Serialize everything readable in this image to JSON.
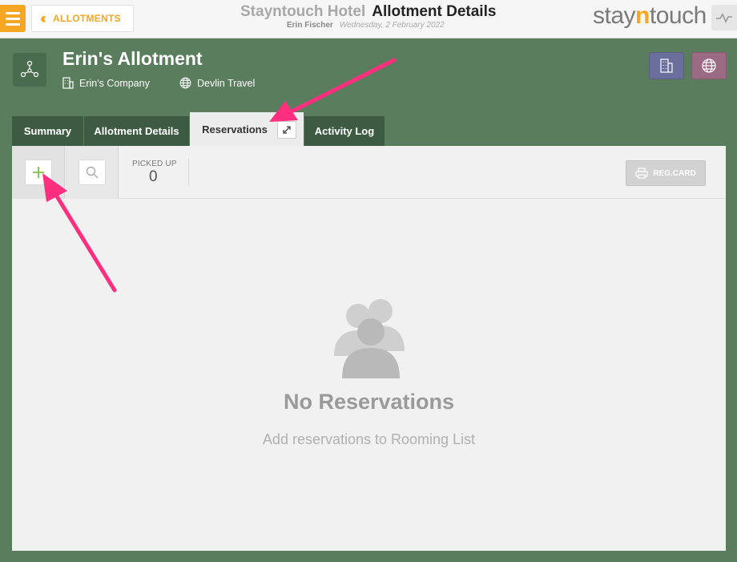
{
  "topbar": {
    "back_label": "ALLOTMENTS",
    "hotel_name": "Stayntouch Hotel",
    "page_title": "Allotment Details",
    "user_name": "Erin Fischer",
    "date": "Wednesday, 2 February 2022",
    "logo": {
      "pre": "stay",
      "mid": "n",
      "post": "touch"
    }
  },
  "allotment": {
    "name": "Erin's Allotment",
    "company": "Erin's Company",
    "travel_agent": "Devlin Travel"
  },
  "tabs": [
    {
      "label": "Summary"
    },
    {
      "label": "Allotment Details"
    },
    {
      "label": "Reservations"
    },
    {
      "label": "Activity Log"
    }
  ],
  "toolbar": {
    "picked_up_label": "PICKED UP",
    "picked_up_value": "0",
    "reg_card_label": "REG.CARD"
  },
  "empty_state": {
    "title": "No Reservations",
    "subtitle": "Add reservations to Rooming List"
  },
  "colors": {
    "accent": "#f5a623",
    "background": "#5a7d5e",
    "tab_dark": "#3d5b42",
    "annotation": "#ff2e7e"
  }
}
